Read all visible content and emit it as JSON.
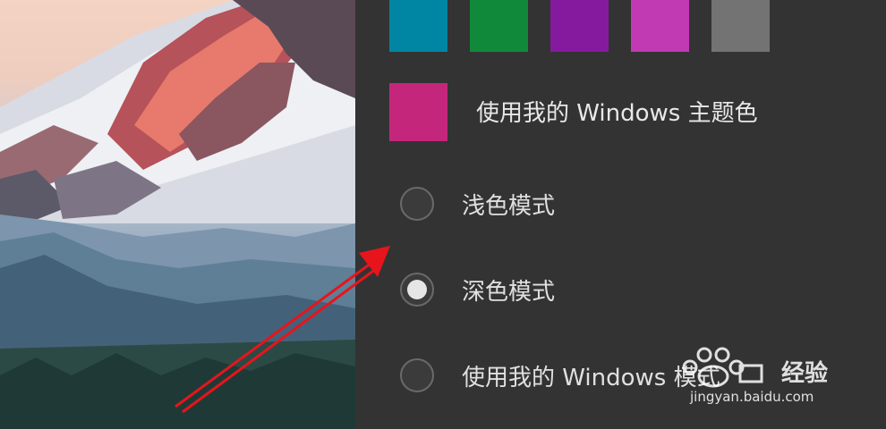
{
  "colors": {
    "swatches": [
      "#0086a2",
      "#108a3a",
      "#861a9e",
      "#c13ab3",
      "#737373"
    ],
    "accent": "#c4267c",
    "panel_bg": "#333333",
    "arrow": "#e8141c"
  },
  "accent_option": {
    "label": "使用我的 Windows 主题色"
  },
  "modes": [
    {
      "label": "浅色模式",
      "checked": false
    },
    {
      "label": "深色模式",
      "checked": true
    },
    {
      "label": "使用我的 Windows 模式",
      "checked": false
    }
  ],
  "watermark": {
    "brand": "经验",
    "url": "jingyan.baidu.com",
    "icon": "paw-icon"
  }
}
